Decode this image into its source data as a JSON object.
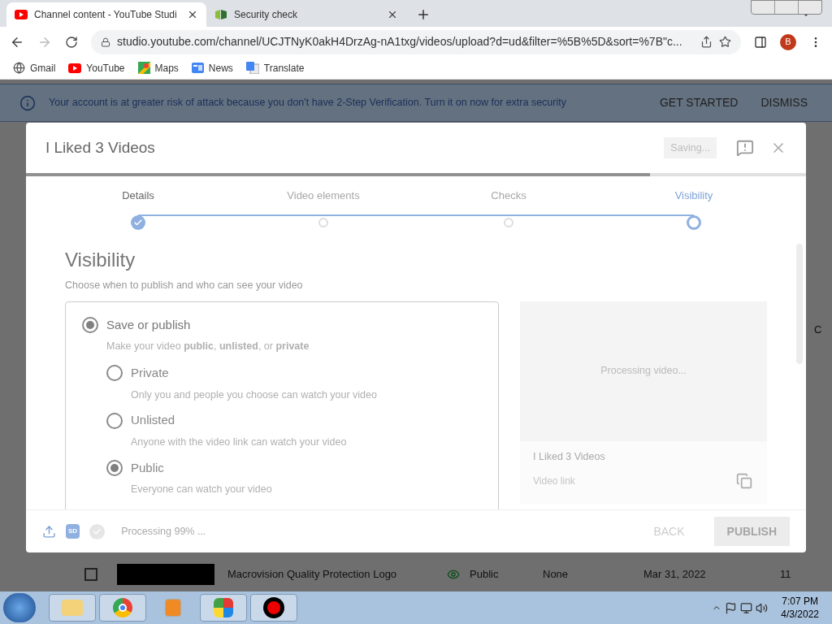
{
  "browser": {
    "tabs": [
      {
        "title": "Channel content - YouTube Studi",
        "selected": true,
        "kind": "youtube"
      },
      {
        "title": "Security check",
        "selected": false,
        "kind": "shield"
      }
    ],
    "url": "studio.youtube.com/channel/UCJTNyK0akH4DrzAg-nA1txg/videos/upload?d=ud&filter=%5B%5D&sort=%7B\"c...",
    "profile": "B",
    "bookmarks": [
      {
        "label": "Gmail",
        "kind": "globe"
      },
      {
        "label": "YouTube",
        "kind": "youtube"
      },
      {
        "label": "Maps",
        "kind": "maps"
      },
      {
        "label": "News",
        "kind": "news"
      },
      {
        "label": "Translate",
        "kind": "translate"
      }
    ]
  },
  "banner": {
    "message": "Your account is at greater risk of attack because you don't have 2-Step Verification. Turn it on now for extra security",
    "actions": [
      "GET STARTED",
      "DISMISS"
    ]
  },
  "background_row": {
    "checked": false,
    "title": "Macrovision Quality Protection Logo",
    "visibility": "Public",
    "restrictions": "None",
    "date": "Mar 31, 2022",
    "views": "11"
  },
  "background_partial_text": "C",
  "dialog": {
    "title": "I Liked 3 Videos",
    "saving": "Saving...",
    "progress": {
      "level": 0.8
    },
    "steps": [
      {
        "label": "Details",
        "completed": true,
        "selected": false
      },
      {
        "label": "Video elements",
        "completed": false,
        "selected": false
      },
      {
        "label": "Checks",
        "completed": false,
        "selected": false
      },
      {
        "label": "Visibility",
        "completed": false,
        "selected": true
      }
    ],
    "heading": "Visibility",
    "subheading": "Choose when to publish and who can see your video",
    "save_option": {
      "label": "Save or publish",
      "selected": true,
      "description": "Make your video **public**, **unlisted**, or **private**"
    },
    "privacy_options": [
      {
        "label": "Private",
        "selected": false,
        "description": "Only you and people you choose can watch your video"
      },
      {
        "label": "Unlisted",
        "selected": false,
        "description": "Anyone with the video link can watch your video"
      },
      {
        "label": "Public",
        "selected": true,
        "description": "Everyone can watch your video"
      }
    ],
    "preview": {
      "status": "Processing video...",
      "title": "I Liked 3 Videos",
      "link_label": "Video link"
    },
    "footer": {
      "status": "Processing 99% ...",
      "hd": "SD",
      "back": "BACK",
      "publish": "PUBLISH",
      "publish_disabled": true
    }
  },
  "taskbar": {
    "time": "7:07 PM",
    "date": "4/3/2022"
  }
}
